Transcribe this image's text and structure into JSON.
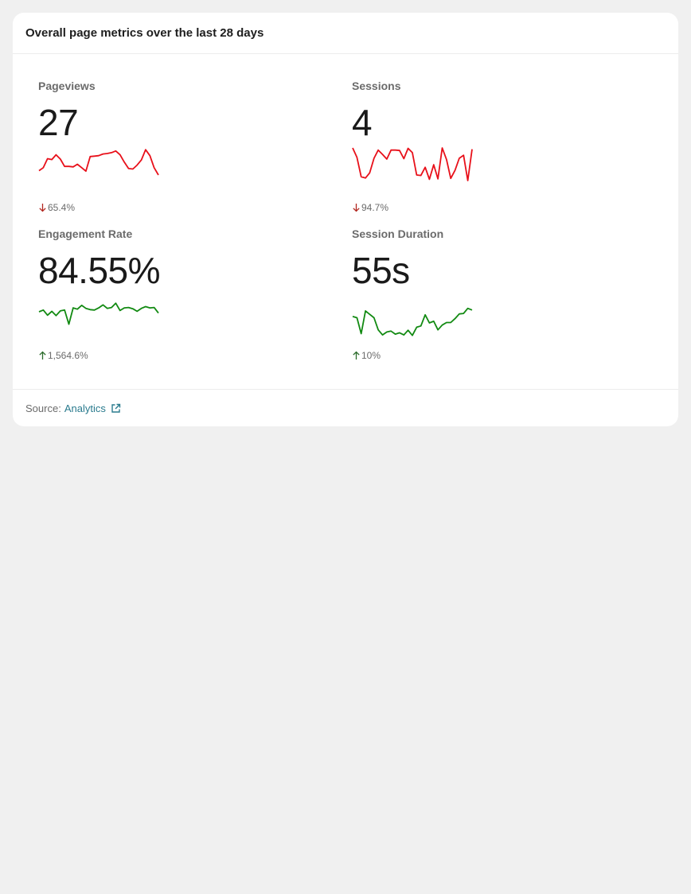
{
  "card": {
    "title": "Overall page metrics over the last 28 days"
  },
  "metrics": [
    {
      "label": "Pageviews",
      "value": "27",
      "change": "65.4%",
      "direction": "down",
      "color": "#e8101a",
      "spark": [
        0.53,
        0.46,
        0.25,
        0.27,
        0.16,
        0.26,
        0.43,
        0.43,
        0.44,
        0.38,
        0.46,
        0.54,
        0.2,
        0.19,
        0.18,
        0.14,
        0.13,
        0.11,
        0.07,
        0.16,
        0.33,
        0.48,
        0.49,
        0.4,
        0.28,
        0.04,
        0.18,
        0.46,
        0.63
      ]
    },
    {
      "label": "Sessions",
      "value": "4",
      "change": "94.7%",
      "direction": "down",
      "color": "#e8101a",
      "spark": [
        0.0,
        0.22,
        0.67,
        0.7,
        0.58,
        0.24,
        0.05,
        0.15,
        0.26,
        0.05,
        0.05,
        0.06,
        0.25,
        0.01,
        0.11,
        0.63,
        0.64,
        0.45,
        0.73,
        0.39,
        0.72,
        0.0,
        0.27,
        0.71,
        0.52,
        0.24,
        0.17,
        0.76,
        0.03
      ]
    },
    {
      "label": "Engagement Rate",
      "value": "84.55%",
      "change": "1,564.6%",
      "direction": "up",
      "color": "#128a12",
      "spark": [
        0.37,
        0.33,
        0.45,
        0.36,
        0.46,
        0.35,
        0.33,
        0.66,
        0.28,
        0.31,
        0.22,
        0.29,
        0.32,
        0.33,
        0.28,
        0.21,
        0.29,
        0.27,
        0.17,
        0.34,
        0.28,
        0.27,
        0.3,
        0.36,
        0.29,
        0.25,
        0.28,
        0.27,
        0.4
      ]
    },
    {
      "label": "Session Duration",
      "value": "55s",
      "change": "10%",
      "direction": "up",
      "color": "#128a12",
      "spark": [
        0.48,
        0.51,
        0.88,
        0.35,
        0.43,
        0.51,
        0.79,
        0.91,
        0.84,
        0.82,
        0.89,
        0.86,
        0.91,
        0.8,
        0.92,
        0.73,
        0.7,
        0.44,
        0.63,
        0.59,
        0.79,
        0.68,
        0.62,
        0.62,
        0.53,
        0.42,
        0.41,
        0.29,
        0.33
      ]
    }
  ],
  "footer": {
    "source_label": "Source:",
    "source_link": "Analytics",
    "link_icon": "external-link-icon"
  }
}
